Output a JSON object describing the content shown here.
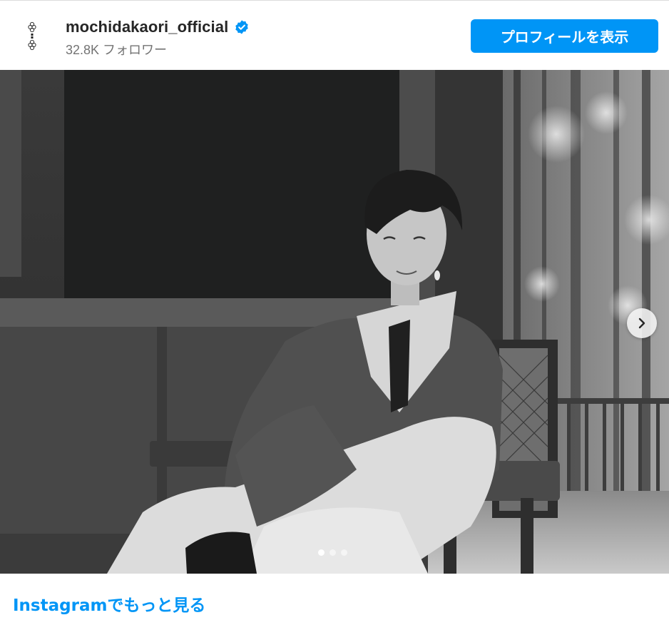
{
  "header": {
    "username": "mochidakaori_official",
    "followers": "32.8K フォロワー",
    "profile_button_label": "プロフィールを表示"
  },
  "media": {
    "carousel_count": 3,
    "active_index": 0
  },
  "footer": {
    "more_link": "Instagramでもっと見る"
  },
  "colors": {
    "accent": "#0095f6",
    "text": "#262626",
    "muted": "#737373"
  }
}
